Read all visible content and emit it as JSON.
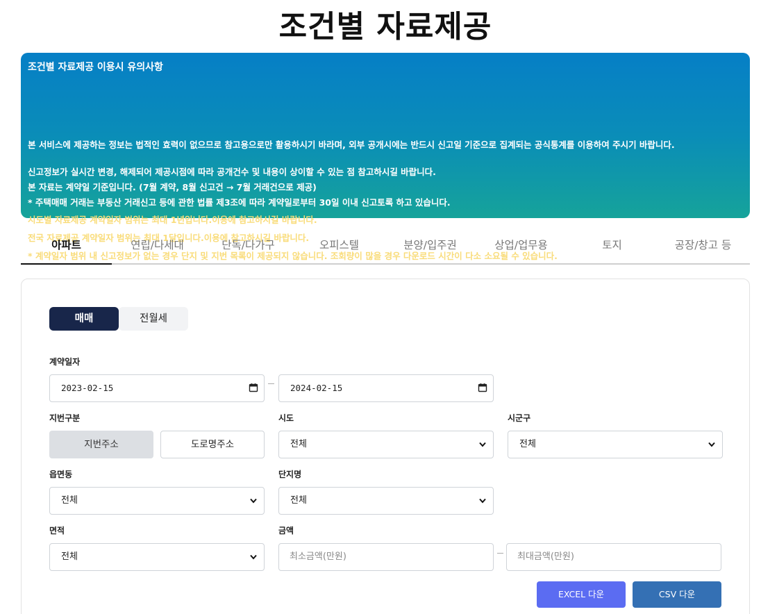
{
  "page": {
    "title": "조건별 자료제공"
  },
  "notice": {
    "title": "조건별 자료제공 이용시 유의사항",
    "line1": "본 서비스에 제공하는 정보는 법적인 효력이 없으므로 참고용으로만 활용하시기 바라며, 외부 공개시에는 반드시 신고일 기준으로 집계되는 공식통계를 이용하여 주시기 바랍니다.",
    "line2": "신고정보가 실시간 변경, 해제되어 제공시점에 따라 공개건수 및 내용이 상이할 수 있는 점 참고하시길 바랍니다.",
    "line3": "본 자료는 계약일 기준입니다. (7월 계약, 8월 신고건 → 7월 거래건으로 제공)",
    "line4": "* 주택매매 거래는 부동산 거래신고 등에 관한 법률 제3조에 따라 계약일로부터 30일 이내 신고토록 하고 있습니다.",
    "line5": "시도별 자료제공 계약일자 범위는 최대 1년입니다.이용에 참고하시길 바랍니다.",
    "line6": "전국 자료제공 계약일자 범위는 최대 1달입니다.이용에 참고하시길 바랍니다.",
    "line7": "* 계약일자 범위 내 신고정보가 없는 경우 단지 및 지번 목록이 제공되지 않습니다. 조회량이 많을 경우 다운로드 시간이 다소 소요될 수 있습니다.",
    "colors": {
      "gradient_top": "#067fc6",
      "gradient_bottom": "#16a39a",
      "highlight": "#f9dc7a"
    }
  },
  "tabs": [
    {
      "label": "아파트",
      "active": true
    },
    {
      "label": "연립/다세대",
      "active": false
    },
    {
      "label": "단독/다가구",
      "active": false
    },
    {
      "label": "오피스텔",
      "active": false
    },
    {
      "label": "분양/입주권",
      "active": false
    },
    {
      "label": "상업/업무용",
      "active": false
    },
    {
      "label": "토지",
      "active": false
    },
    {
      "label": "공장/창고 등",
      "active": false
    }
  ],
  "trade_type": {
    "sale": "매매",
    "lease": "전월세",
    "selected": "매매"
  },
  "form": {
    "contract_date": {
      "label": "계약일자",
      "from": "2023-02-15",
      "to": "2024-02-15"
    },
    "lot_type": {
      "label": "지번구분",
      "option_lot": "지번주소",
      "option_road": "도로명주소",
      "selected": "지번주소"
    },
    "sido": {
      "label": "시도",
      "value": "전체"
    },
    "sigungu": {
      "label": "시군구",
      "value": "전체"
    },
    "eupmyeondong": {
      "label": "읍면동",
      "value": "전체"
    },
    "complex": {
      "label": "단지명",
      "value": "전체"
    },
    "area": {
      "label": "면적",
      "value": "전체"
    },
    "amount": {
      "label": "금액",
      "min_placeholder": "최소금액(만원)",
      "max_placeholder": "최대금액(만원)"
    }
  },
  "downloads": {
    "excel": "EXCEL 다운",
    "csv": "CSV 다운",
    "colors": {
      "excel": "#5b6cf2",
      "csv": "#3470b4"
    }
  },
  "icons": {
    "calendar": "calendar-icon",
    "dropdown": "chevron-down-icon"
  }
}
